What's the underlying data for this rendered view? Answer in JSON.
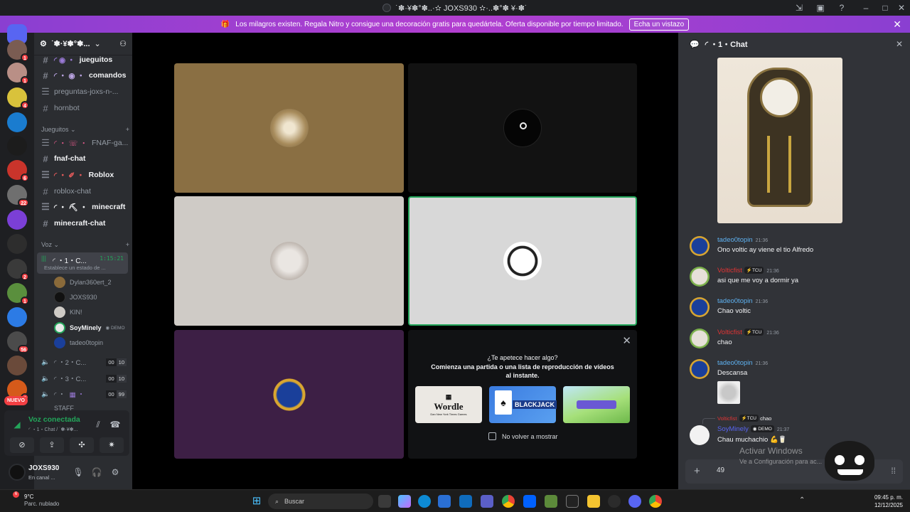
{
  "window": {
    "title": "˙✽·¥✽°✽..·✫ JOXS930 ✫·..✽°✽ ¥·✽˙"
  },
  "banner": {
    "text": "Los milagros existen. Regala Nitro y consigue una decoración gratis para quedártela. Oferta disponible por tiempo limitado.",
    "button_label": "Echa un vistazo"
  },
  "servers": [
    {
      "badge": "1",
      "color": "#7a5c52"
    },
    {
      "badge": "1",
      "color": "#b98f86"
    },
    {
      "badge": "4",
      "color": "#d9c23b"
    },
    {
      "badge": "",
      "color": "#1a7ccf"
    },
    {
      "badge": "",
      "color": "#1c1c1c"
    },
    {
      "badge": "6",
      "color": "#c9342b"
    },
    {
      "badge": "22",
      "color": "#6f6f6f"
    },
    {
      "badge": "",
      "color": "#7b3fd6"
    },
    {
      "badge": "",
      "color": "#2d2d2d"
    },
    {
      "badge": "2",
      "color": "#3a3a3a"
    },
    {
      "badge": "1",
      "color": "#5a8f3d"
    },
    {
      "badge": "",
      "color": "#2c7be5"
    },
    {
      "badge": "56",
      "color": "#4b4b4b"
    },
    {
      "badge": "",
      "color": "#6a4a3a"
    },
    {
      "badge": "6",
      "color": "#d55a1a"
    }
  ],
  "new_label": "NUEVO",
  "sidebar": {
    "server_name": "˙✽·¥✽°✽...",
    "channels_top": [
      {
        "name": "jueguitos",
        "type": "text",
        "bright": true
      },
      {
        "name": "comandos",
        "type": "text",
        "bright": true
      },
      {
        "name": "preguntas-joxs-n-...",
        "type": "forum",
        "bright": false
      },
      {
        "name": "hornbot",
        "type": "text",
        "bright": false
      }
    ],
    "category_games": "Jueguitos",
    "channels_games": [
      {
        "name": "FNAF-ga...",
        "type": "forum",
        "bright": false
      },
      {
        "name": "fnaf-chat",
        "type": "text",
        "bright": true
      },
      {
        "name": "Roblox",
        "type": "forum",
        "bright": true
      },
      {
        "name": "roblox-chat",
        "type": "text",
        "bright": false
      },
      {
        "name": "minecraft",
        "type": "forum",
        "bright": true
      },
      {
        "name": "minecraft-chat",
        "type": "text",
        "bright": true
      }
    ],
    "category_voice": "Voz",
    "active_voice": {
      "name": "◜ ・1・C...",
      "timer": "1:15:21",
      "status": "Establece un estado de ..."
    },
    "members": [
      "Dylan360ert_2",
      "JOXS930",
      "KIN!",
      "SoyMinely",
      "tadeo0topin"
    ],
    "demo_tag": "DEMO",
    "voice_channels": [
      {
        "name": "◜ ・2・C...",
        "count_a": "00",
        "count_b": "10"
      },
      {
        "name": "◜ ・3・C...",
        "count_a": "00",
        "count_b": "10"
      },
      {
        "name": "◜ ・",
        "count_a": "00",
        "count_b": "99"
      }
    ],
    "staff_label": "STAFF"
  },
  "voice_panel": {
    "status": "Voz conectada",
    "subtitle": "◜ ・1・Chat / ˙✽·¥✽..."
  },
  "user_panel": {
    "username": "JOXS930",
    "status": "En canal ..."
  },
  "activity": {
    "heading": "¿Te apetece hacer algo?",
    "subheading": "Comienza una partida o una lista de reproducción de vídeos al instante.",
    "cards": [
      "Wordle",
      "BLACKJACK",
      ""
    ],
    "wordle_sub": "Dan New York Times Games",
    "checkbox_label": "No volver a mostrar"
  },
  "chat": {
    "header_title": "◜ ・1・Chat",
    "messages": [
      {
        "author": "tadeo0topin",
        "author_color": "#5eb1f0",
        "tag": "",
        "time": "21:36",
        "text": "Ono voltic ay viene el tio Alfredo"
      },
      {
        "author": "Volticfist",
        "author_color": "#e03434",
        "tag": "TCU",
        "time": "21:36",
        "text": "asi que me voy a dormir ya"
      },
      {
        "author": "tadeo0topin",
        "author_color": "#5eb1f0",
        "tag": "",
        "time": "21:36",
        "text": "Chao voltic"
      },
      {
        "author": "Volticfist",
        "author_color": "#e03434",
        "tag": "TCU",
        "time": "21:36",
        "text": "chao"
      },
      {
        "author": "tadeo0topin",
        "author_color": "#5eb1f0",
        "tag": "",
        "time": "21:36",
        "text": "Descansa"
      }
    ],
    "reply": {
      "author": "Volticfist",
      "tag": "TCU",
      "text": "chao"
    },
    "last_message": {
      "author": "SoyMinely",
      "author_color": "#5865f2",
      "tag": "DEMO",
      "time": "21:37",
      "text": "Chau muchachio"
    },
    "composer_value": "49"
  },
  "watermark": {
    "line1": "Activar Windows",
    "line2": "Ve a Configuración para ac..."
  },
  "taskbar": {
    "weather_temp": "9°C",
    "weather_desc": "Parc. nublado",
    "weather_badge": "6",
    "search_placeholder": "Buscar",
    "time": "09:45 p. m.",
    "date": "12/12/2025"
  },
  "colors": {
    "accent_green": "#23a55a",
    "tile_brown": "#8a6f43",
    "tile_black": "#121212",
    "tile_grey": "#cfcbc6",
    "tile_light": "#d8d8d8",
    "tile_purple": "#3d1f45",
    "speaking_border": "#23a55a"
  }
}
